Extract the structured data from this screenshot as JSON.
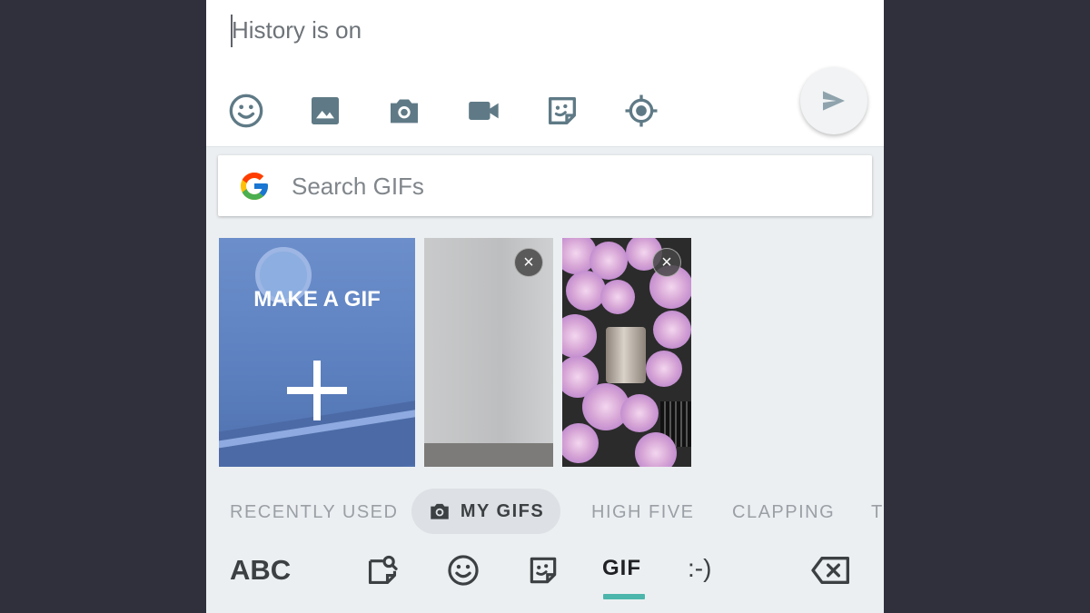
{
  "compose": {
    "placeholder": "History is on",
    "toolbar_icons": [
      "emoji-icon",
      "image-icon",
      "camera-icon",
      "video-icon",
      "sticker-icon",
      "location-icon"
    ],
    "send_icon": "send-icon"
  },
  "search": {
    "placeholder": "Search GIFs",
    "logo": "google-g-logo"
  },
  "gifs": {
    "make_gif_label": "MAKE A GIF",
    "tiles": [
      {
        "name": "make-a-gif-tile",
        "icon": "plus-icon"
      },
      {
        "name": "my-gif-wall",
        "removable": true
      },
      {
        "name": "my-gif-roses",
        "removable": true
      }
    ],
    "remove_symbol": "×"
  },
  "categories": {
    "items": [
      {
        "label": "RECENTLY USED"
      },
      {
        "label": "MY GIFS",
        "active": true,
        "icon": "camera-icon"
      },
      {
        "label": "HIGH FIVE"
      },
      {
        "label": "CLAPPING"
      },
      {
        "label": "T"
      }
    ]
  },
  "keyboard_bar": {
    "abc_label": "ABC",
    "gif_label": "GIF",
    "emoticon_label": ":-)",
    "active_tab": "GIF",
    "icons": [
      "sticker-search-icon",
      "emoji-icon",
      "sticker-icon",
      "backspace-icon"
    ]
  },
  "colors": {
    "background": "#2f303b",
    "panel": "#eceff1",
    "icon_gray": "#5f7a86",
    "accent_teal": "#4db6ac"
  }
}
